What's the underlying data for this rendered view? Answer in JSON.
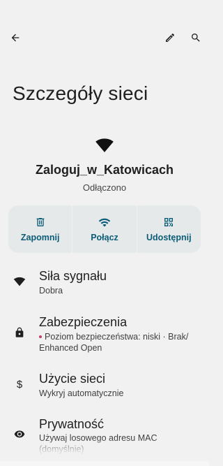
{
  "page": {
    "title": "Szczegóły sieci"
  },
  "network": {
    "ssid": "Zaloguj_w_Katowicach",
    "status": "Odłączono"
  },
  "actions": [
    {
      "label": "Zapomnij",
      "icon": "trash-icon"
    },
    {
      "label": "Połącz",
      "icon": "wifi-icon"
    },
    {
      "label": "Udostępnij",
      "icon": "qr-code-icon"
    }
  ],
  "details": [
    {
      "title": "Siła sygnału",
      "subtitle": "Dobra",
      "icon": "wifi-signal-icon"
    },
    {
      "title": "Zabezpieczenia",
      "subtitle": "Poziom bezpieczeństwa: niski · Brak/ Enhanced Open",
      "icon": "lock-icon"
    },
    {
      "title": "Użycie sieci",
      "subtitle": "Wykryj automatycznie",
      "icon": "dollar-icon"
    },
    {
      "title": "Prywatność",
      "subtitle": "Używaj losowego adresu MAC (domyślnie)",
      "icon": "eye-icon"
    }
  ],
  "colors": {
    "accent": "#0b5d77",
    "background": "#f1f1f1",
    "card": "#e6e9ea",
    "warning_dot": "#c0406a"
  }
}
